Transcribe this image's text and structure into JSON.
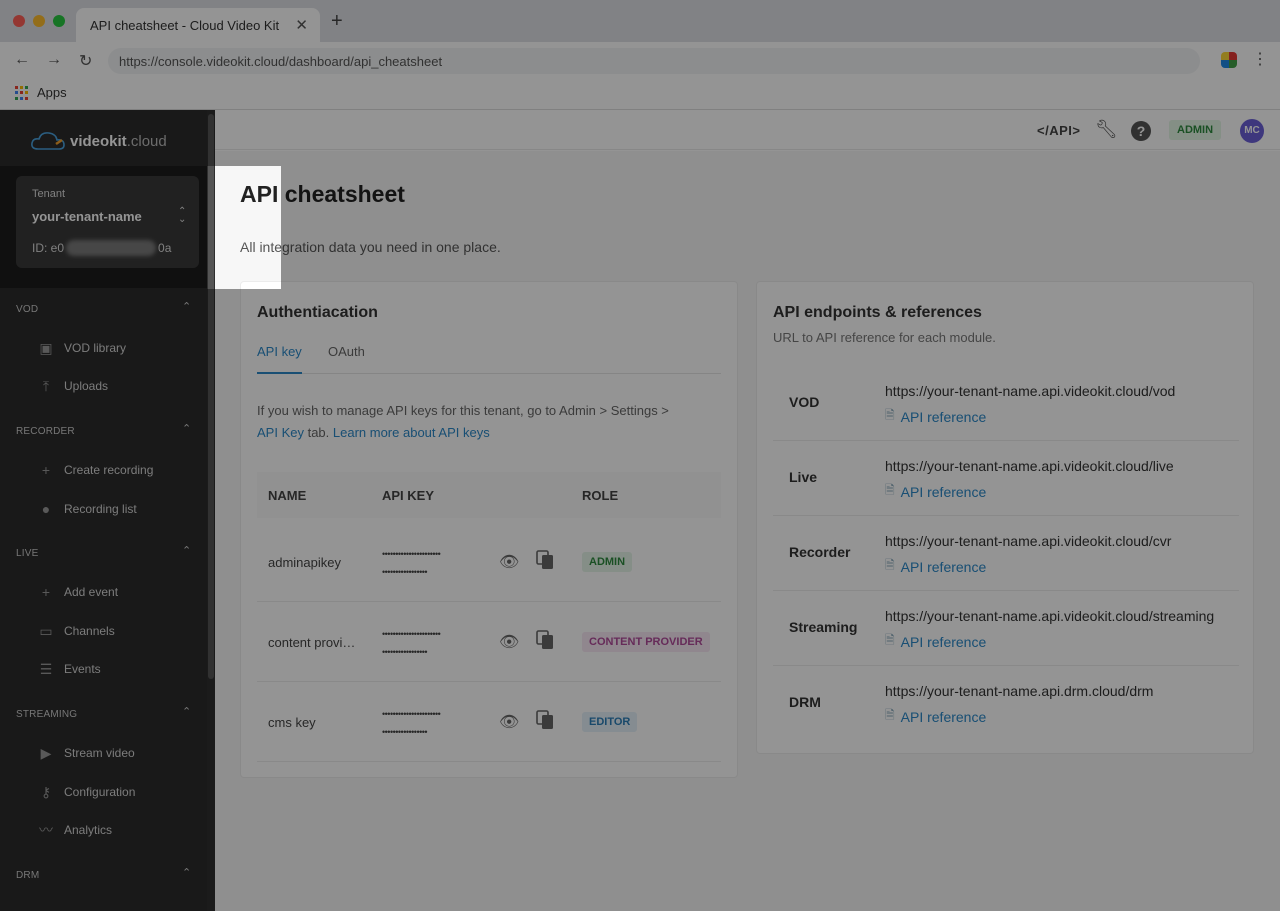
{
  "browser": {
    "tab_title": "API cheatsheet - Cloud Video Kit",
    "url": "https://console.videokit.cloud/dashboard/api_cheatsheet",
    "bookmarks_apps": "Apps"
  },
  "sidebar": {
    "logo": {
      "bold": "videokit",
      "light": ".cloud"
    },
    "tenant": {
      "label": "Tenant",
      "name": "your-tenant-name",
      "id_prefix": "ID: e0",
      "id_suffix": "0a"
    },
    "sections": [
      {
        "title": "VOD",
        "items": [
          {
            "label": "VOD library",
            "icon": "vod-library-icon"
          },
          {
            "label": "Uploads",
            "icon": "upload-icon"
          }
        ]
      },
      {
        "title": "RECORDER",
        "items": [
          {
            "label": "Create recording",
            "icon": "plus-icon"
          },
          {
            "label": "Recording list",
            "icon": "record-dot-icon"
          }
        ]
      },
      {
        "title": "LIVE",
        "items": [
          {
            "label": "Add event",
            "icon": "plus-icon"
          },
          {
            "label": "Channels",
            "icon": "monitor-icon"
          },
          {
            "label": "Events",
            "icon": "list-icon"
          }
        ]
      },
      {
        "title": "STREAMING",
        "items": [
          {
            "label": "Stream video",
            "icon": "play-circle-icon"
          },
          {
            "label": "Configuration",
            "icon": "key-icon"
          },
          {
            "label": "Analytics",
            "icon": "trend-icon"
          }
        ]
      },
      {
        "title": "DRM",
        "items": []
      }
    ]
  },
  "topbar": {
    "api_link": "</API>",
    "admin_badge": "ADMIN",
    "avatar_initials": "MC"
  },
  "page": {
    "title": "API cheatsheet",
    "subtitle": "All integration data you need in one place."
  },
  "auth": {
    "title": "Authentiacation",
    "tabs": [
      "API key",
      "OAuth"
    ],
    "info_text": "If you wish to manage API keys for this tenant, go to Admin > Settings >",
    "info_link1": "API Key",
    "info_mid": " tab. ",
    "info_link2": "Learn more about API keys",
    "columns": [
      "NAME",
      "API KEY",
      "ROLE"
    ],
    "keys": [
      {
        "name": "adminapikey",
        "mask1": "••••••••••••••••••••••",
        "mask2": "•••••••••••••••••",
        "role": "ADMIN",
        "role_color": "#2e8b3e",
        "role_bg": "#e6f5e8"
      },
      {
        "name": "content provi…",
        "mask1": "••••••••••••••••••••••",
        "mask2": "•••••••••••••••••",
        "role": "CONTENT PROVIDER",
        "role_color": "#b04a9a",
        "role_bg": "#f8e8f4"
      },
      {
        "name": "cms key",
        "mask1": "••••••••••••••••••••••",
        "mask2": "•••••••••••••••••",
        "role": "EDITOR",
        "role_color": "#2b7fb8",
        "role_bg": "#e6f1fa"
      }
    ]
  },
  "api": {
    "title": "API endpoints & references",
    "subtitle": "URL to API reference for each module.",
    "endpoints": [
      {
        "name": "VOD",
        "url": "https://your-tenant-name.api.videokit.cloud/vod",
        "ref": "API reference"
      },
      {
        "name": "Live",
        "url": "https://your-tenant-name.api.videokit.cloud/live",
        "ref": "API reference"
      },
      {
        "name": "Recorder",
        "url": "https://your-tenant-name.api.videokit.cloud/cvr",
        "ref": "API reference"
      },
      {
        "name": "Streaming",
        "url": "https://your-tenant-name.api.videokit.cloud/streaming",
        "ref": "API reference"
      },
      {
        "name": "DRM",
        "url": "https://your-tenant-name.api.drm.cloud/drm",
        "ref": "API reference"
      }
    ]
  }
}
